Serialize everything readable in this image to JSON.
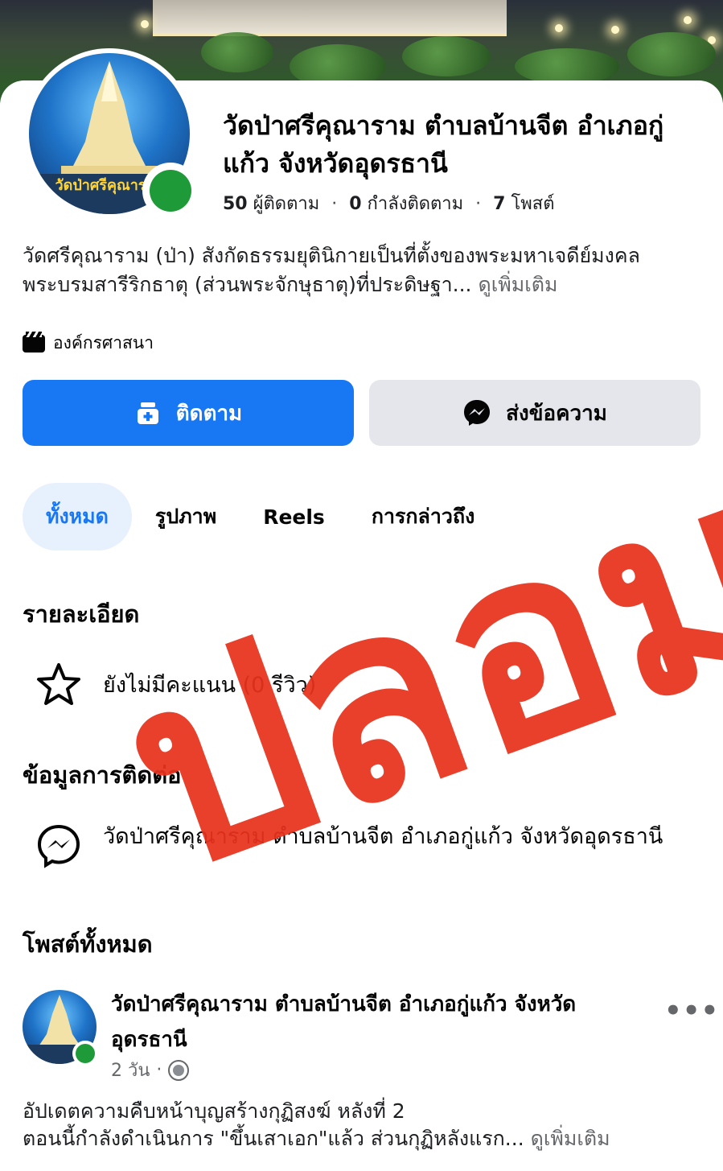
{
  "page": {
    "name": "วัดป่าศรีคุณาราม ตำบลบ้านจีต อำเภอกู่แก้ว จังหวัดอุดรธานี",
    "followers_count": "50",
    "followers_label": "ผู้ติดตาม",
    "following_count": "0",
    "following_label": "กำลังติดตาม",
    "posts_count": "7",
    "posts_label": "โพสต์",
    "about_text": "วัดศรีคุณาราม (ป่า) สังกัดธรรมยุตินิกายเป็นที่ตั้งของพระมหาเจดีย์มงคล พระบรมสารีริกธาตุ (ส่วนพระจักษุธาตุ)ที่ประดิษฐา...",
    "about_more": "ดูเพิ่มเติม",
    "category": "องค์กรศาสนา",
    "avatar_text": "วัดป่าศรีคุณาราม"
  },
  "actions": {
    "follow_label": "ติดตาม",
    "message_label": "ส่งข้อความ"
  },
  "tabs": [
    {
      "label": "ทั้งหมด",
      "active": true
    },
    {
      "label": "รูปภาพ",
      "active": false
    },
    {
      "label": "Reels",
      "active": false
    },
    {
      "label": "การกล่าวถึง",
      "active": false
    }
  ],
  "details": {
    "title": "รายละเอียด",
    "rating_text": "ยังไม่มีคะแนน (0 รีวิว)"
  },
  "contact": {
    "title": "ข้อมูลการติดต่อ",
    "messenger_text": "วัดป่าศรีคุณาราม ตำบลบ้านจีต อำเภอกู่แก้ว จังหวัดอุดรธานี"
  },
  "posts": {
    "title": "โพสต์ทั้งหมด",
    "items": [
      {
        "author": "วัดป่าศรีคุณาราม ตำบลบ้านจีต อำเภอกู่แก้ว จังหวัดอุดรธานี",
        "time": "2 วัน",
        "body_line1": "อัปเดตความคืบหน้าบุญสร้างกุฏิสงฆ์ หลังที่ 2",
        "body_line2": "ตอนนี้กำลังดำเนินการ \"ขึ้นเสาเอก\"แล้ว ส่วนกุฏิหลังแรก...",
        "more": "ดูเพิ่มเติม"
      }
    ]
  },
  "stamp": {
    "text": "ปลอม",
    "color": "#e8321d"
  },
  "colors": {
    "primary": "#1877f2",
    "online": "#1e9a38",
    "secondary_bg": "#e4e6eb"
  }
}
